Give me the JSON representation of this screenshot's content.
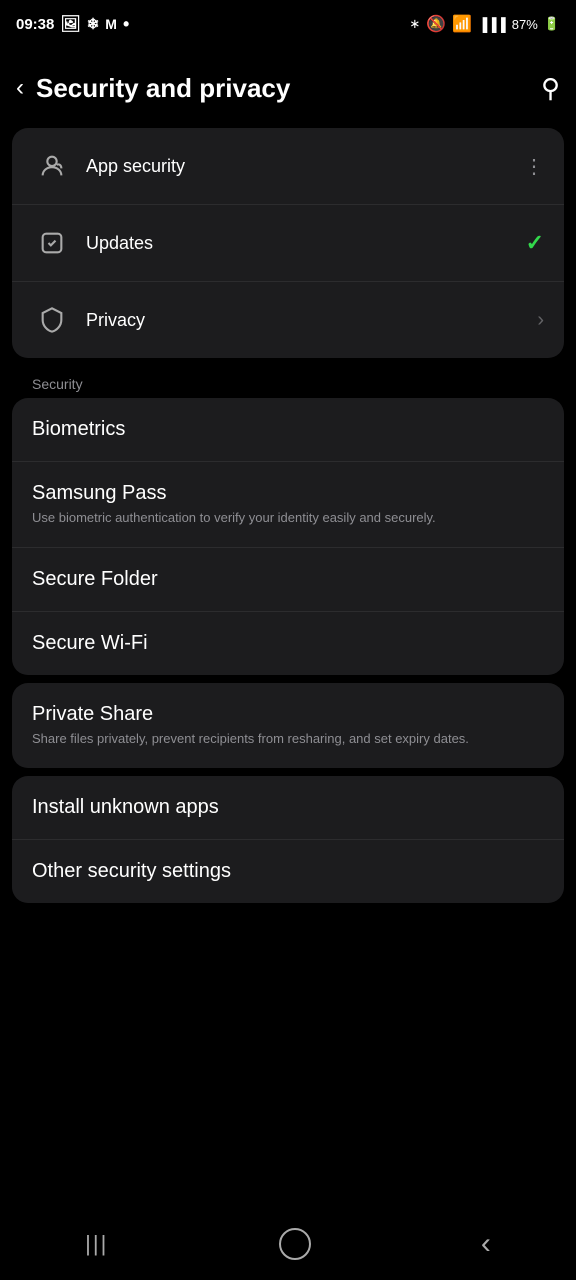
{
  "statusBar": {
    "time": "09:38",
    "batteryPercent": "87%"
  },
  "header": {
    "backLabel": "‹",
    "title": "Security and privacy",
    "searchLabel": "⌕"
  },
  "topCard": {
    "items": [
      {
        "id": "app-security",
        "title": "App security",
        "suffix": "dots",
        "hasIcon": true,
        "iconType": "app-security"
      },
      {
        "id": "updates",
        "title": "Updates",
        "suffix": "check",
        "hasIcon": true,
        "iconType": "updates"
      },
      {
        "id": "privacy",
        "title": "Privacy",
        "suffix": "chevron",
        "hasIcon": true,
        "iconType": "privacy"
      }
    ]
  },
  "sectionLabel": "Security",
  "securityCard": {
    "items": [
      {
        "id": "biometrics",
        "title": "Biometrics",
        "subtitle": ""
      },
      {
        "id": "samsung-pass",
        "title": "Samsung Pass",
        "subtitle": "Use biometric authentication to verify your identity easily and securely."
      },
      {
        "id": "secure-folder",
        "title": "Secure Folder",
        "subtitle": ""
      },
      {
        "id": "secure-wifi",
        "title": "Secure Wi-Fi",
        "subtitle": ""
      }
    ]
  },
  "privateShareCard": {
    "title": "Private Share",
    "subtitle": "Share files privately, prevent recipients from resharing, and set expiry dates."
  },
  "bottomCard": {
    "items": [
      {
        "id": "install-unknown",
        "title": "Install unknown apps"
      },
      {
        "id": "other-security",
        "title": "Other security settings"
      }
    ]
  },
  "navBar": {
    "recentIcon": "|||",
    "homeIcon": "○",
    "backIcon": "‹"
  }
}
